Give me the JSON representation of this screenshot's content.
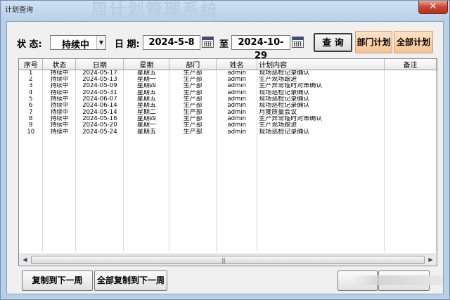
{
  "window": {
    "title": "计划查询",
    "ghost_title": "周计划管理系统",
    "close_glyph": "✕"
  },
  "filter": {
    "status_label": "状  态:",
    "status_value": "持续中",
    "date_label": "日  期:",
    "date_from": "2024-5-8",
    "to_label": "至",
    "date_to": "2024-10-29"
  },
  "buttons": {
    "query": "查 询",
    "dept_plan": "部门计划",
    "all_plan": "全部计划",
    "copy_next_week": "复制到下一周",
    "copy_all_next_week": "全部复制到下一周"
  },
  "table": {
    "columns": [
      "序号",
      "状态",
      "日期",
      "星期",
      "部门",
      "姓名",
      "计划内容",
      "备注"
    ],
    "rows": [
      [
        "1",
        "持续中",
        "2024-05-17",
        "星期五",
        "生产部",
        "admin",
        "现场巡检记录确认",
        ""
      ],
      [
        "2",
        "持续中",
        "2024-05-13",
        "星期一",
        "生产部",
        "admin",
        "生产现场跟进",
        ""
      ],
      [
        "3",
        "持续中",
        "2024-05-09",
        "星期四",
        "生产部",
        "admin",
        "生产异常临时对策确认",
        ""
      ],
      [
        "4",
        "持续中",
        "2024-05-31",
        "星期五",
        "生产部",
        "admin",
        "现场巡检记录确认",
        ""
      ],
      [
        "5",
        "持续中",
        "2024-06-07",
        "星期五",
        "生产部",
        "admin",
        "现场巡检记录确认",
        ""
      ],
      [
        "6",
        "持续中",
        "2024-06-14",
        "星期五",
        "生产部",
        "admin",
        "现场巡检记录确认",
        ""
      ],
      [
        "7",
        "持续中",
        "2024-05-14",
        "星期二",
        "生产部",
        "admin",
        "月度质量会议",
        ""
      ],
      [
        "8",
        "持续中",
        "2024-05-16",
        "星期四",
        "生产部",
        "admin",
        "生产异常临时对策确认",
        ""
      ],
      [
        "9",
        "持续中",
        "2024-05-20",
        "星期一",
        "生产部",
        "admin",
        "生产现场跟进",
        ""
      ],
      [
        "10",
        "持续中",
        "2024-05-24",
        "星期五",
        "生产部",
        "admin",
        "现场巡检记录确认",
        ""
      ]
    ]
  },
  "scrollbar": {
    "left_arrow": "◀",
    "right_arrow": "▶",
    "grip": "|||"
  },
  "icons": {
    "combo_arrow": "▼"
  }
}
